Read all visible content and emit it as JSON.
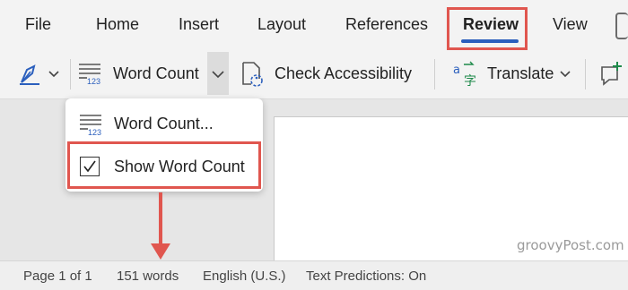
{
  "tabs": [
    {
      "label": "File"
    },
    {
      "label": "Home"
    },
    {
      "label": "Insert"
    },
    {
      "label": "Layout"
    },
    {
      "label": "References"
    },
    {
      "label": "Review"
    },
    {
      "label": "View"
    }
  ],
  "active_tab": "Review",
  "toolbar": {
    "word_count_label": "Word Count",
    "check_accessibility_label": "Check Accessibility",
    "translate_label": "Translate",
    "word_count_icon_digits": "123"
  },
  "word_count_menu": {
    "items": [
      {
        "label": "Word Count..."
      },
      {
        "label": "Show Word Count",
        "checked": true
      }
    ]
  },
  "status_bar": {
    "page": "Page 1 of 1",
    "words": "151 words",
    "language": "English (U.S.)",
    "predictions": "Text Predictions: On"
  },
  "watermark": "groovyPost.com",
  "colors": {
    "highlight": "#e0564f",
    "accent_blue": "#2b5fbd",
    "translate_green": "#1e8a4a"
  }
}
